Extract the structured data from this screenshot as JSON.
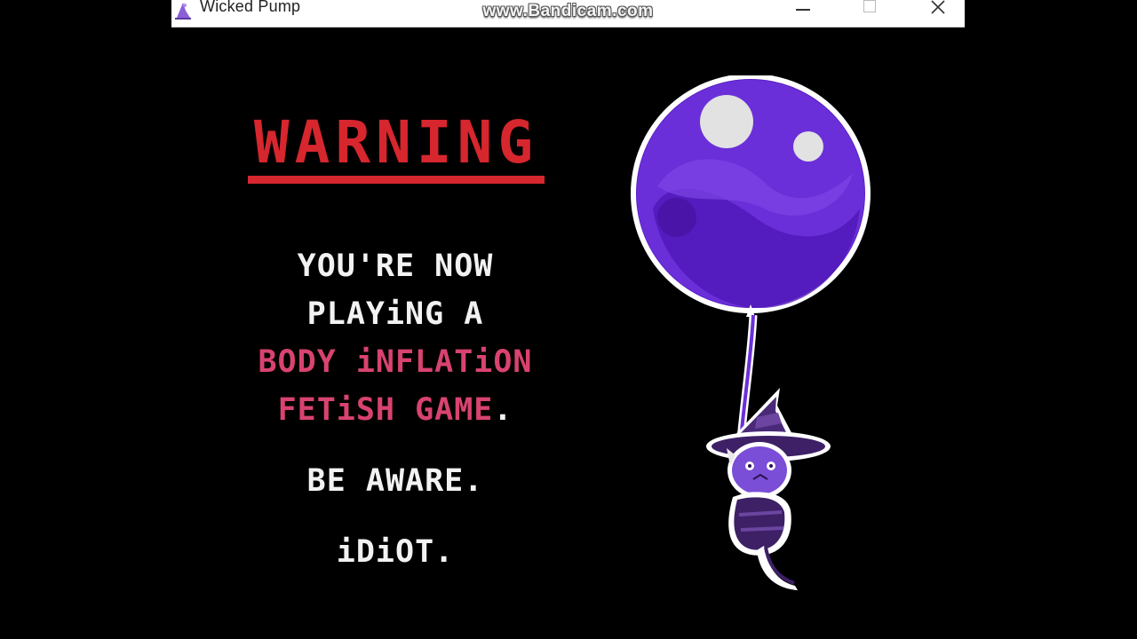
{
  "window": {
    "title": "Wicked Pump",
    "watermark": "www.Bandicam.com",
    "controls": {
      "minimize": "minimize",
      "maximize": "maximize",
      "close": "close"
    }
  },
  "screen": {
    "heading": "WARNING",
    "lines": [
      {
        "text": "YOU'RE NOW"
      },
      {
        "text": "PLAYiNG A"
      },
      {
        "text": "BODY iNFLATiON"
      },
      {
        "text": "FETiSH GAME",
        "suffix": "."
      },
      {
        "text": "BE AWARE."
      },
      {
        "text": "iDiOT."
      }
    ]
  },
  "icons": {
    "app": "wizard-hat-icon",
    "minimize": "minimize-icon",
    "maximize": "maximize-icon",
    "close": "close-icon",
    "art": "balloon-witch-illustration"
  },
  "colors": {
    "background": "#000000",
    "warning": "#d6262e",
    "highlight": "#d8436f",
    "text": "#f2f2f2",
    "balloon": "#6b2fd9"
  }
}
